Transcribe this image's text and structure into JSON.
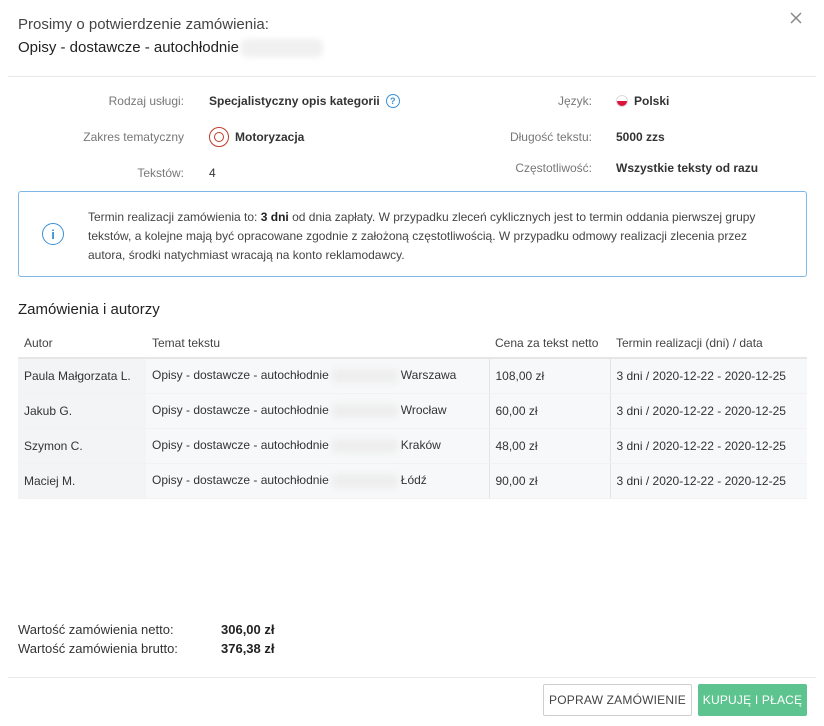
{
  "header": {
    "title": "Prosimy o potwierdzenie zamówienia:",
    "subtitle": "Opisy - dostawcze - autochłodnie"
  },
  "details": {
    "service_label": "Rodzaj usługi:",
    "service_value": "Specjalistyczny opis kategorii",
    "language_label": "Język:",
    "language_value": "Polski",
    "scope_label": "Zakres tematyczny",
    "scope_value": "Motoryzacja",
    "length_label": "Długość tekstu:",
    "length_value": "5000 zzs",
    "texts_label": "Tekstów:",
    "texts_value": "4",
    "frequency_label": "Częstotliwość:",
    "frequency_value": "Wszystkie teksty od razu"
  },
  "notice": {
    "part1": "Termin realizacji zamówienia to: ",
    "days": "3 dni",
    "part2": " od dnia zapłaty. W przypadku zleceń cyklicznych jest to termin oddania pierwszej grupy tekstów, a kolejne mają być opracowane zgodnie z założoną częstotliwością. W przypadku odmowy realizacji zlecenia przez autora, środki natychmiast wracają na konto reklamodawcy."
  },
  "orders": {
    "title": "Zamówienia i autorzy",
    "columns": [
      "Autor",
      "Temat tekstu",
      "Cena za tekst netto",
      "Termin realizacji (dni) / data"
    ],
    "rows": [
      {
        "author": "Paula Małgorzata L.",
        "topic_start": "Opisy - dostawcze - autochłodnie",
        "topic_end": "Warszawa",
        "price": "108,00 zł",
        "deadline": "3 dni / 2020-12-22 - 2020-12-25"
      },
      {
        "author": "Jakub G.",
        "topic_start": "Opisy - dostawcze - autochłodnie",
        "topic_end": "Wrocław",
        "price": "60,00 zł",
        "deadline": "3 dni / 2020-12-22 - 2020-12-25"
      },
      {
        "author": "Szymon C.",
        "topic_start": "Opisy - dostawcze - autochłodnie",
        "topic_end": "Kraków",
        "price": "48,00 zł",
        "deadline": "3 dni / 2020-12-22 - 2020-12-25"
      },
      {
        "author": "Maciej M.",
        "topic_start": "Opisy - dostawcze - autochłodnie",
        "topic_end": "Łódź",
        "price": "90,00 zł",
        "deadline": "3 dni / 2020-12-22 - 2020-12-25"
      }
    ]
  },
  "totals": {
    "net_label": "Wartość zamówienia netto:",
    "net_value": "306,00 zł",
    "gross_label": "Wartość zamówienia brutto:",
    "gross_value": "376,38 zł"
  },
  "actions": {
    "edit_label": "Popraw zamówienie",
    "buy_label": "Kupuję i płacę"
  },
  "icons": {
    "close": "close-icon",
    "help": "help-icon",
    "flag": "poland-flag-icon",
    "category": "steering-wheel-icon",
    "info": "info-icon"
  },
  "colors": {
    "accent_blue": "#3a8fd6",
    "primary_green": "#5ec48f",
    "category_red": "#c0392b"
  }
}
